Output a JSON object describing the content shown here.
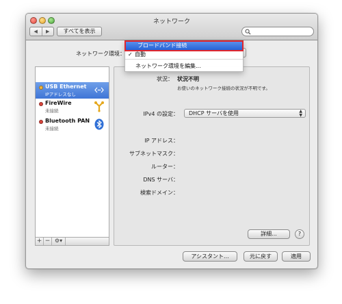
{
  "window": {
    "title": "ネットワーク"
  },
  "toolbar": {
    "back_glyph": "◀",
    "forward_glyph": "▶",
    "show_all_label": "すべてを表示",
    "search_placeholder": "",
    "search_value": ""
  },
  "location": {
    "label": "ネットワーク環境：",
    "menu": {
      "highlighted": "ブロードバンド接続",
      "checked_item": "自動",
      "check_mark": "✓",
      "edit_item": "ネットワーク環境を編集..."
    }
  },
  "services": [
    {
      "name": "USB Ethernet",
      "status": "IPアドレスなし",
      "dot_color": "#f2b43a",
      "icon": "ethernet-icon",
      "selected": true
    },
    {
      "name": "FireWire",
      "status": "未接続",
      "dot_color": "#d9443b",
      "icon": "firewire-icon",
      "selected": false
    },
    {
      "name": "Bluetooth PAN",
      "status": "未接続",
      "dot_color": "#d9443b",
      "icon": "bluetooth-icon",
      "selected": false
    }
  ],
  "service_tools": {
    "add": "+",
    "remove": "−",
    "gear": "⚙▾"
  },
  "detail": {
    "status_label": "状況：",
    "status_value": "状況不明",
    "status_desc": "お使いのネットワーク接続の状況が不明です。",
    "ipv4_label": "IPv4 の設定：",
    "ipv4_value": "DHCP サーバを使用",
    "ip_label": "IP アドレス：",
    "subnet_label": "サブネットマスク：",
    "router_label": "ルーター：",
    "dns_label": "DNS サーバ：",
    "search_domain_label": "検索ドメイン：",
    "advanced_label": "詳細...",
    "help_label": "?"
  },
  "footer": {
    "assistant_label": "アシスタント...",
    "revert_label": "元に戻す",
    "apply_label": "適用"
  },
  "colors": {
    "selection": "#3f75d6",
    "highlight_outline": "#e0262d"
  }
}
